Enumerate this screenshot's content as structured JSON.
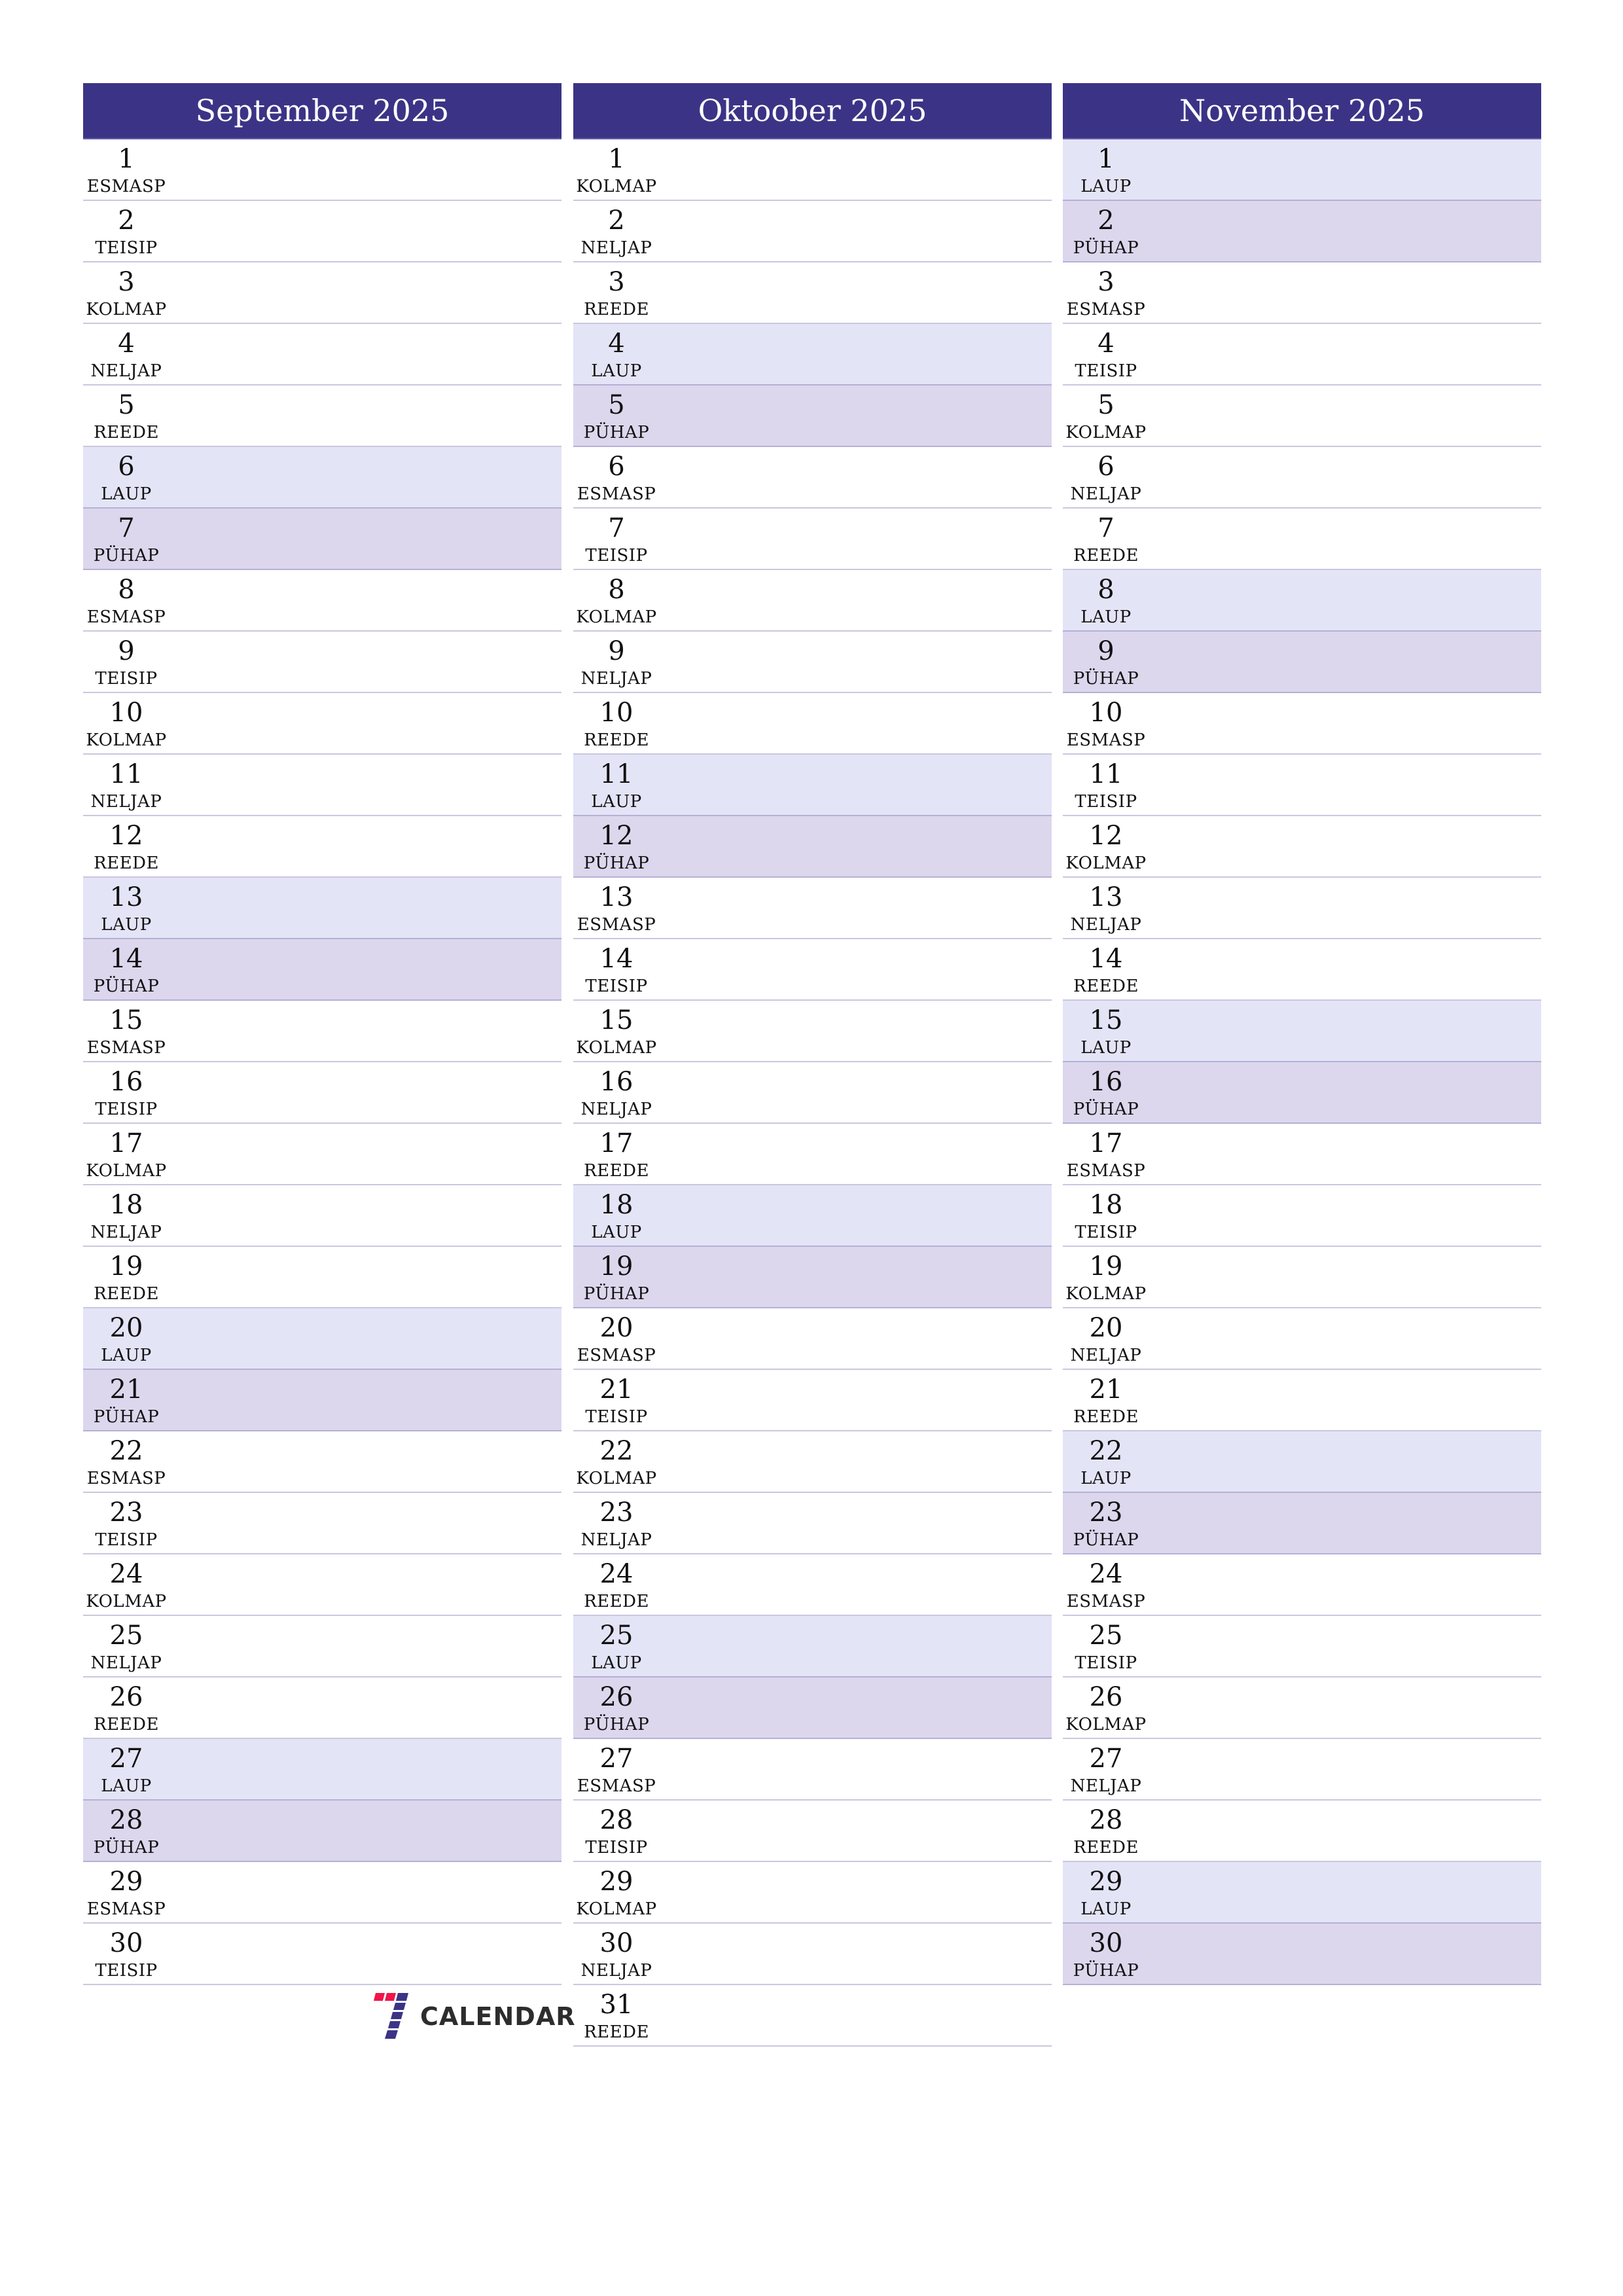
{
  "colors": {
    "header_bg": "#3b3486",
    "saturday_bg": "#e4e4f7",
    "sunday_bg": "#dcd7ed",
    "divider": "#cac7de",
    "logo_red": "#f0144a",
    "logo_blue": "#3b3486"
  },
  "months": [
    {
      "title": "September 2025",
      "days": [
        {
          "n": "1",
          "d": "ESMASP",
          "t": ""
        },
        {
          "n": "2",
          "d": "TEISIP",
          "t": ""
        },
        {
          "n": "3",
          "d": "KOLMAP",
          "t": ""
        },
        {
          "n": "4",
          "d": "NELJAP",
          "t": ""
        },
        {
          "n": "5",
          "d": "REEDE",
          "t": ""
        },
        {
          "n": "6",
          "d": "LAUP",
          "t": "sat"
        },
        {
          "n": "7",
          "d": "PÜHAP",
          "t": "sun"
        },
        {
          "n": "8",
          "d": "ESMASP",
          "t": ""
        },
        {
          "n": "9",
          "d": "TEISIP",
          "t": ""
        },
        {
          "n": "10",
          "d": "KOLMAP",
          "t": ""
        },
        {
          "n": "11",
          "d": "NELJAP",
          "t": ""
        },
        {
          "n": "12",
          "d": "REEDE",
          "t": ""
        },
        {
          "n": "13",
          "d": "LAUP",
          "t": "sat"
        },
        {
          "n": "14",
          "d": "PÜHAP",
          "t": "sun"
        },
        {
          "n": "15",
          "d": "ESMASP",
          "t": ""
        },
        {
          "n": "16",
          "d": "TEISIP",
          "t": ""
        },
        {
          "n": "17",
          "d": "KOLMAP",
          "t": ""
        },
        {
          "n": "18",
          "d": "NELJAP",
          "t": ""
        },
        {
          "n": "19",
          "d": "REEDE",
          "t": ""
        },
        {
          "n": "20",
          "d": "LAUP",
          "t": "sat"
        },
        {
          "n": "21",
          "d": "PÜHAP",
          "t": "sun"
        },
        {
          "n": "22",
          "d": "ESMASP",
          "t": ""
        },
        {
          "n": "23",
          "d": "TEISIP",
          "t": ""
        },
        {
          "n": "24",
          "d": "KOLMAP",
          "t": ""
        },
        {
          "n": "25",
          "d": "NELJAP",
          "t": ""
        },
        {
          "n": "26",
          "d": "REEDE",
          "t": ""
        },
        {
          "n": "27",
          "d": "LAUP",
          "t": "sat"
        },
        {
          "n": "28",
          "d": "PÜHAP",
          "t": "sun"
        },
        {
          "n": "29",
          "d": "ESMASP",
          "t": ""
        },
        {
          "n": "30",
          "d": "TEISIP",
          "t": ""
        }
      ]
    },
    {
      "title": "Oktoober 2025",
      "days": [
        {
          "n": "1",
          "d": "KOLMAP",
          "t": ""
        },
        {
          "n": "2",
          "d": "NELJAP",
          "t": ""
        },
        {
          "n": "3",
          "d": "REEDE",
          "t": ""
        },
        {
          "n": "4",
          "d": "LAUP",
          "t": "sat"
        },
        {
          "n": "5",
          "d": "PÜHAP",
          "t": "sun"
        },
        {
          "n": "6",
          "d": "ESMASP",
          "t": ""
        },
        {
          "n": "7",
          "d": "TEISIP",
          "t": ""
        },
        {
          "n": "8",
          "d": "KOLMAP",
          "t": ""
        },
        {
          "n": "9",
          "d": "NELJAP",
          "t": ""
        },
        {
          "n": "10",
          "d": "REEDE",
          "t": ""
        },
        {
          "n": "11",
          "d": "LAUP",
          "t": "sat"
        },
        {
          "n": "12",
          "d": "PÜHAP",
          "t": "sun"
        },
        {
          "n": "13",
          "d": "ESMASP",
          "t": ""
        },
        {
          "n": "14",
          "d": "TEISIP",
          "t": ""
        },
        {
          "n": "15",
          "d": "KOLMAP",
          "t": ""
        },
        {
          "n": "16",
          "d": "NELJAP",
          "t": ""
        },
        {
          "n": "17",
          "d": "REEDE",
          "t": ""
        },
        {
          "n": "18",
          "d": "LAUP",
          "t": "sat"
        },
        {
          "n": "19",
          "d": "PÜHAP",
          "t": "sun"
        },
        {
          "n": "20",
          "d": "ESMASP",
          "t": ""
        },
        {
          "n": "21",
          "d": "TEISIP",
          "t": ""
        },
        {
          "n": "22",
          "d": "KOLMAP",
          "t": ""
        },
        {
          "n": "23",
          "d": "NELJAP",
          "t": ""
        },
        {
          "n": "24",
          "d": "REEDE",
          "t": ""
        },
        {
          "n": "25",
          "d": "LAUP",
          "t": "sat"
        },
        {
          "n": "26",
          "d": "PÜHAP",
          "t": "sun"
        },
        {
          "n": "27",
          "d": "ESMASP",
          "t": ""
        },
        {
          "n": "28",
          "d": "TEISIP",
          "t": ""
        },
        {
          "n": "29",
          "d": "KOLMAP",
          "t": ""
        },
        {
          "n": "30",
          "d": "NELJAP",
          "t": ""
        },
        {
          "n": "31",
          "d": "REEDE",
          "t": ""
        }
      ]
    },
    {
      "title": "November 2025",
      "days": [
        {
          "n": "1",
          "d": "LAUP",
          "t": "sat"
        },
        {
          "n": "2",
          "d": "PÜHAP",
          "t": "sun"
        },
        {
          "n": "3",
          "d": "ESMASP",
          "t": ""
        },
        {
          "n": "4",
          "d": "TEISIP",
          "t": ""
        },
        {
          "n": "5",
          "d": "KOLMAP",
          "t": ""
        },
        {
          "n": "6",
          "d": "NELJAP",
          "t": ""
        },
        {
          "n": "7",
          "d": "REEDE",
          "t": ""
        },
        {
          "n": "8",
          "d": "LAUP",
          "t": "sat"
        },
        {
          "n": "9",
          "d": "PÜHAP",
          "t": "sun"
        },
        {
          "n": "10",
          "d": "ESMASP",
          "t": ""
        },
        {
          "n": "11",
          "d": "TEISIP",
          "t": ""
        },
        {
          "n": "12",
          "d": "KOLMAP",
          "t": ""
        },
        {
          "n": "13",
          "d": "NELJAP",
          "t": ""
        },
        {
          "n": "14",
          "d": "REEDE",
          "t": ""
        },
        {
          "n": "15",
          "d": "LAUP",
          "t": "sat"
        },
        {
          "n": "16",
          "d": "PÜHAP",
          "t": "sun"
        },
        {
          "n": "17",
          "d": "ESMASP",
          "t": ""
        },
        {
          "n": "18",
          "d": "TEISIP",
          "t": ""
        },
        {
          "n": "19",
          "d": "KOLMAP",
          "t": ""
        },
        {
          "n": "20",
          "d": "NELJAP",
          "t": ""
        },
        {
          "n": "21",
          "d": "REEDE",
          "t": ""
        },
        {
          "n": "22",
          "d": "LAUP",
          "t": "sat"
        },
        {
          "n": "23",
          "d": "PÜHAP",
          "t": "sun"
        },
        {
          "n": "24",
          "d": "ESMASP",
          "t": ""
        },
        {
          "n": "25",
          "d": "TEISIP",
          "t": ""
        },
        {
          "n": "26",
          "d": "KOLMAP",
          "t": ""
        },
        {
          "n": "27",
          "d": "NELJAP",
          "t": ""
        },
        {
          "n": "28",
          "d": "REEDE",
          "t": ""
        },
        {
          "n": "29",
          "d": "LAUP",
          "t": "sat"
        },
        {
          "n": "30",
          "d": "PÜHAP",
          "t": "sun"
        }
      ]
    }
  ],
  "logo": {
    "text": "CALENDAR",
    "icon": "seven-calendar-logo-icon"
  }
}
